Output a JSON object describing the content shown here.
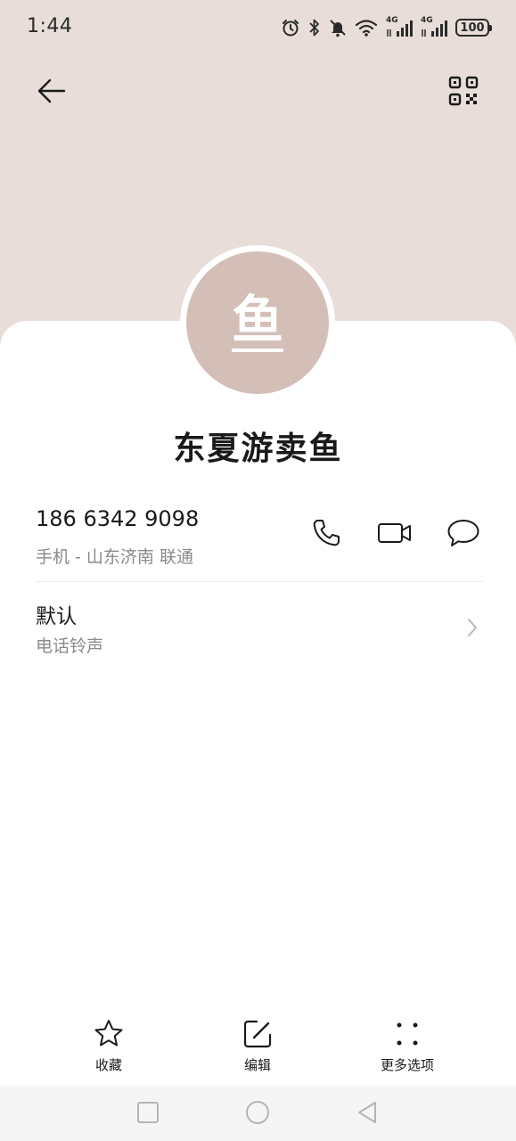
{
  "status_bar": {
    "time": "1:44",
    "network_1": "4G",
    "network_2": "4G",
    "battery": "100",
    "icons": [
      "alarm-icon",
      "bluetooth-icon",
      "mute-icon",
      "wifi-icon",
      "signal-icon",
      "signal-icon",
      "battery-icon"
    ]
  },
  "header": {
    "back_icon": "arrow-left-icon",
    "qr_icon": "qr-code-icon",
    "background_color": "#e8ddd8"
  },
  "contact": {
    "avatar_text": "鱼",
    "avatar_color": "#d4bfb8",
    "name": "东夏游卖鱼"
  },
  "phone": {
    "number": "186 6342 9098",
    "detail": "手机 - 山东济南 联通",
    "actions": [
      "phone-icon",
      "video-icon",
      "message-icon"
    ]
  },
  "ringtone": {
    "value": "默认",
    "label": "电话铃声"
  },
  "bottom_actions": [
    {
      "label": "收藏",
      "icon": "star-icon"
    },
    {
      "label": "编辑",
      "icon": "edit-icon"
    },
    {
      "label": "更多选项",
      "icon": "more-icon"
    }
  ],
  "nav": [
    "recents-icon",
    "home-icon",
    "back-icon"
  ]
}
